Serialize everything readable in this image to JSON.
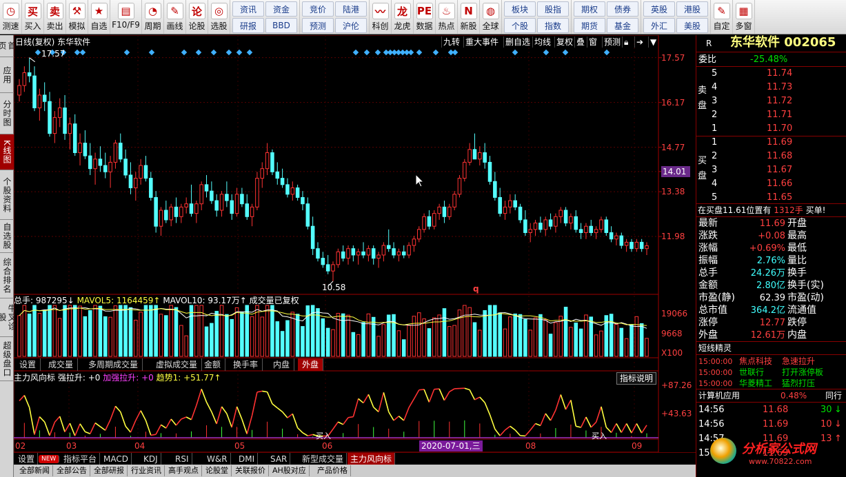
{
  "toolbar": {
    "items": [
      {
        "label": "测速",
        "icon": "stopwatch-icon",
        "glyph": "◷"
      },
      {
        "label": "买入",
        "icon": "buy-icon",
        "glyph": "买"
      },
      {
        "label": "卖出",
        "icon": "sell-icon",
        "glyph": "卖"
      },
      {
        "label": "模拟",
        "icon": "hammer-icon",
        "glyph": "⚒"
      },
      {
        "label": "自选",
        "icon": "star-icon",
        "glyph": "★"
      },
      {
        "label": "F10/F9",
        "icon": "document-icon",
        "glyph": "▤"
      },
      {
        "label": "周期",
        "icon": "clock-icon",
        "glyph": "◔"
      },
      {
        "label": "画线",
        "icon": "pen-icon",
        "glyph": "✎"
      },
      {
        "label": "论股",
        "icon": "chat-icon",
        "glyph": "论"
      },
      {
        "label": "选股",
        "icon": "target-icon",
        "glyph": "◎"
      }
    ],
    "grid1": [
      "资讯",
      "资金",
      "研报",
      "BBD"
    ],
    "grid2": [
      "竞价",
      "陆港",
      "预测",
      "沪伦"
    ],
    "items2": [
      {
        "label": "科创",
        "icon": "chart-icon",
        "glyph": "〰"
      },
      {
        "label": "龙虎",
        "icon": "dragon-icon",
        "glyph": "龙"
      },
      {
        "label": "数据",
        "icon": "pe-icon",
        "glyph": "PE"
      },
      {
        "label": "热点",
        "icon": "fire-icon",
        "glyph": "♨"
      },
      {
        "label": "新股",
        "icon": "new-stock-icon",
        "glyph": "N"
      },
      {
        "label": "全球",
        "icon": "globe-icon",
        "glyph": "◍"
      }
    ],
    "grid3": [
      "板块",
      "股指",
      "个股",
      "指数"
    ],
    "grid4": [
      "期权",
      "债券",
      "期货",
      "基金"
    ],
    "grid5": [
      "英股",
      "港股",
      "外汇",
      "美股"
    ],
    "items3": [
      {
        "label": "自定",
        "icon": "custom-icon",
        "glyph": "✎"
      },
      {
        "label": "多窗",
        "icon": "multiwindow-icon",
        "glyph": "▦"
      }
    ]
  },
  "sidetabs": [
    "首页",
    "应用",
    "分时图",
    "K线图",
    "个股资料",
    "自选股",
    "综合排名",
    "牛叉诊股",
    "超级盘口"
  ],
  "chart_header": {
    "title": "日线(复权) 东华软件",
    "buttons": [
      "九转",
      "重大事件",
      "删自选",
      "均线",
      "复权",
      "叠",
      "窗",
      "预测"
    ]
  },
  "price_axis": [
    "17.57",
    "16.17",
    "14.77",
    "14.01",
    "13.38",
    "11.98"
  ],
  "annotations": {
    "high": "17.57",
    "low": "10.58",
    "marker": "q"
  },
  "volume_header": {
    "total": "总手: 987295↓",
    "mavol5": "MAVOL5: 1164459↑",
    "mavol10": "MAVOL10: 93.17万↑",
    "note": "成交量已复权"
  },
  "volume_axis": [
    "19066",
    "9668",
    "X100"
  ],
  "volume_tabs": [
    "设置",
    "成交量",
    "多周期成交量",
    "虚拟成交量",
    "金额",
    "换手率",
    "内盘",
    "外盘"
  ],
  "indicator_header": {
    "name": "主力风向标",
    "s1": "强拉升: +0",
    "s2": "加强拉升: +0",
    "s3": "趋势1: +51.77↑",
    "btn": "指标说明"
  },
  "indicator_axis": [
    "+87.26",
    "+43.63"
  ],
  "indicator_labels": [
    "买入",
    "买入"
  ],
  "date_axis": [
    "02",
    "03",
    "04",
    "05",
    "06",
    "07",
    "08",
    "09"
  ],
  "cursor_date": "2020-07-01,三",
  "bottom_tabs": [
    "设置",
    "NEW",
    "指标平台",
    "MACD",
    "KDJ",
    "RSI",
    "W&R",
    "DMI",
    "SAR",
    "新型成交量",
    "主力风向标"
  ],
  "bottom_tabs2": [
    "全部新闻",
    "全部公告",
    "全部研报",
    "行业资讯",
    "高手观点",
    "论股堂",
    "关联报价",
    "AH股对应",
    "产品价格"
  ],
  "quote": {
    "code_flag": "R",
    "name": "东华软件",
    "code": "002065",
    "weibi_label": "委比",
    "weibi": "-25.48%",
    "sell_label": "卖盘",
    "buy_label": "买盘",
    "sells": [
      {
        "n": "5",
        "p": "11.74"
      },
      {
        "n": "4",
        "p": "11.73"
      },
      {
        "n": "3",
        "p": "11.72"
      },
      {
        "n": "2",
        "p": "11.71"
      },
      {
        "n": "1",
        "p": "11.70"
      }
    ],
    "buys": [
      {
        "n": "1",
        "p": "11.69"
      },
      {
        "n": "2",
        "p": "11.68"
      },
      {
        "n": "3",
        "p": "11.67"
      },
      {
        "n": "4",
        "p": "11.66"
      },
      {
        "n": "5",
        "p": "11.65"
      }
    ],
    "notice_a": "在买盘11.61位置有",
    "notice_b": "1312手",
    "notice_c": "买单!",
    "stats": [
      {
        "l": "最新",
        "v": "11.69",
        "c": "red",
        "l2": "开盘"
      },
      {
        "l": "涨跌",
        "v": "+0.08",
        "c": "red",
        "l2": "最高"
      },
      {
        "l": "涨幅",
        "v": "+0.69%",
        "c": "red",
        "l2": "最低"
      },
      {
        "l": "振幅",
        "v": "2.76%",
        "c": "cyan",
        "l2": "量比"
      },
      {
        "l": "总手",
        "v": "24.26万",
        "c": "cyan",
        "l2": "换手"
      },
      {
        "l": "金额",
        "v": "2.80亿",
        "c": "cyan",
        "l2": "换手(实)"
      },
      {
        "l": "市盈(静)",
        "v": "62.39",
        "c": "wht",
        "l2": "市盈(动)"
      },
      {
        "l": "总市值",
        "v": "364.2亿",
        "c": "cyan",
        "l2": "流通值"
      },
      {
        "l": "涨停",
        "v": "12.77",
        "c": "red",
        "l2": "跌停"
      },
      {
        "l": "外盘",
        "v": "12.61万",
        "c": "red",
        "l2": "内盘"
      }
    ],
    "elf_title": "短线精灵",
    "elf": [
      {
        "t": "15:00:00",
        "a": "焦点科技",
        "b": "急速拉升"
      },
      {
        "t": "15:00:00",
        "a": "世联行",
        "b": "打开涨停板"
      },
      {
        "t": "15:00:00",
        "a": "华菱精工",
        "b": "猛烈打压"
      }
    ],
    "calc_label": "计算机应用",
    "calc_pct": "0.48%",
    "calc_next": "同行",
    "ticks": [
      {
        "t": "14:56",
        "p": "11.68",
        "v": "30",
        "d": "↓",
        "c": "grn"
      },
      {
        "t": "14:56",
        "p": "11.69",
        "v": "10",
        "d": "↓",
        "c": "red"
      },
      {
        "t": "14:57",
        "p": "11.69",
        "v": "13",
        "d": "↑",
        "c": "red"
      },
      {
        "t": "15",
        "p": "11.69",
        "v": "",
        "d": "",
        "c": "red"
      }
    ],
    "watermark": "分析家公式网",
    "watermark_url": "www.70822.com"
  },
  "chart_data": {
    "type": "candlestick",
    "title": "日线(复权) 东华软件",
    "ylim": [
      10.3,
      17.8
    ],
    "x_months": [
      "02",
      "03",
      "04",
      "05",
      "06",
      "07",
      "08",
      "09"
    ],
    "ohlc": [
      [
        16.4,
        16.9,
        16.2,
        16.7
      ],
      [
        16.7,
        17.3,
        16.5,
        17.1
      ],
      [
        17.1,
        17.57,
        16.8,
        17.0
      ],
      [
        17.0,
        17.3,
        15.9,
        16.0
      ],
      [
        16.0,
        16.6,
        15.6,
        16.4
      ],
      [
        16.4,
        16.8,
        15.9,
        16.2
      ],
      [
        16.2,
        16.5,
        15.1,
        15.2
      ],
      [
        15.2,
        15.9,
        14.9,
        15.7
      ],
      [
        15.7,
        16.3,
        15.4,
        16.0
      ],
      [
        16.0,
        16.4,
        15.0,
        15.2
      ],
      [
        15.2,
        15.7,
        14.7,
        15.5
      ],
      [
        15.5,
        15.8,
        14.5,
        14.6
      ],
      [
        14.6,
        15.2,
        14.2,
        14.9
      ],
      [
        14.9,
        15.3,
        14.4,
        14.5
      ],
      [
        14.5,
        14.9,
        13.9,
        14.1
      ],
      [
        14.1,
        14.6,
        13.6,
        14.4
      ],
      [
        14.4,
        14.8,
        14.0,
        14.2
      ],
      [
        14.2,
        14.6,
        13.8,
        14.0
      ],
      [
        14.0,
        14.5,
        13.5,
        14.3
      ],
      [
        14.3,
        15.0,
        14.1,
        14.9
      ],
      [
        14.9,
        15.2,
        14.3,
        14.4
      ],
      [
        14.4,
        14.7,
        13.8,
        13.9
      ],
      [
        13.9,
        14.3,
        13.3,
        13.5
      ],
      [
        13.5,
        14.0,
        13.1,
        13.8
      ],
      [
        13.8,
        14.4,
        13.6,
        14.2
      ],
      [
        14.2,
        14.5,
        13.7,
        13.8
      ],
      [
        13.8,
        14.0,
        13.1,
        13.2
      ],
      [
        13.2,
        13.4,
        12.1,
        12.3
      ],
      [
        12.3,
        12.9,
        12.0,
        12.8
      ],
      [
        12.8,
        13.1,
        12.4,
        12.5
      ],
      [
        12.5,
        13.0,
        12.3,
        12.9
      ],
      [
        12.9,
        13.2,
        12.4,
        12.6
      ],
      [
        12.6,
        13.0,
        12.4,
        12.9
      ],
      [
        12.9,
        13.2,
        12.7,
        13.0
      ],
      [
        13.0,
        13.6,
        12.6,
        12.7
      ],
      [
        12.7,
        13.1,
        12.4,
        13.0
      ],
      [
        13.0,
        13.7,
        12.8,
        13.6
      ],
      [
        13.6,
        13.9,
        13.2,
        13.4
      ],
      [
        13.4,
        13.7,
        13.0,
        13.1
      ],
      [
        13.1,
        13.3,
        12.6,
        12.8
      ],
      [
        12.8,
        13.4,
        12.6,
        13.3
      ],
      [
        13.3,
        13.7,
        12.9,
        13.1
      ],
      [
        13.1,
        13.3,
        12.5,
        12.7
      ],
      [
        12.7,
        13.5,
        12.6,
        13.3
      ],
      [
        13.3,
        13.5,
        12.9,
        13.0
      ],
      [
        13.0,
        13.3,
        12.5,
        12.6
      ],
      [
        12.6,
        13.0,
        12.3,
        12.9
      ],
      [
        12.9,
        14.0,
        12.8,
        13.8
      ],
      [
        13.8,
        14.3,
        13.5,
        14.1
      ],
      [
        14.1,
        14.9,
        13.9,
        14.6
      ],
      [
        14.6,
        14.7,
        13.9,
        14.0
      ],
      [
        14.0,
        14.3,
        13.6,
        13.8
      ],
      [
        13.8,
        14.1,
        13.5,
        13.6
      ],
      [
        13.6,
        13.8,
        13.2,
        13.3
      ],
      [
        13.3,
        13.7,
        13.1,
        13.5
      ],
      [
        13.5,
        13.6,
        13.1,
        13.2
      ],
      [
        13.2,
        13.4,
        12.8,
        13.0
      ],
      [
        13.0,
        13.2,
        12.2,
        12.3
      ],
      [
        12.3,
        12.6,
        11.4,
        11.6
      ],
      [
        11.6,
        11.8,
        11.2,
        11.3
      ],
      [
        11.3,
        11.5,
        11.0,
        11.1
      ],
      [
        11.1,
        11.4,
        10.8,
        10.9
      ],
      [
        10.9,
        11.2,
        10.58,
        11.1
      ],
      [
        11.1,
        11.6,
        11.0,
        11.5
      ],
      [
        11.5,
        11.7,
        11.2,
        11.3
      ],
      [
        11.3,
        11.7,
        11.1,
        11.6
      ],
      [
        11.6,
        11.7,
        11.2,
        11.4
      ],
      [
        11.4,
        11.6,
        11.1,
        11.5
      ],
      [
        11.5,
        11.8,
        11.3,
        11.4
      ],
      [
        11.4,
        11.7,
        11.2,
        11.6
      ],
      [
        11.6,
        11.7,
        11.1,
        11.3
      ],
      [
        11.3,
        11.5,
        11.0,
        11.4
      ],
      [
        11.4,
        11.8,
        11.2,
        11.7
      ],
      [
        11.7,
        12.2,
        11.5,
        11.6
      ],
      [
        11.6,
        11.8,
        11.3,
        11.4
      ],
      [
        11.4,
        11.6,
        11.2,
        11.5
      ],
      [
        11.5,
        11.7,
        11.3,
        11.4
      ],
      [
        11.4,
        11.8,
        11.3,
        11.7
      ],
      [
        11.7,
        12.0,
        11.5,
        11.9
      ],
      [
        11.9,
        12.3,
        11.8,
        12.2
      ],
      [
        12.2,
        12.7,
        12.1,
        12.6
      ],
      [
        12.6,
        12.8,
        12.2,
        12.3
      ],
      [
        12.3,
        12.8,
        12.2,
        12.7
      ],
      [
        12.7,
        13.0,
        12.5,
        12.9
      ],
      [
        12.9,
        13.1,
        12.4,
        12.6
      ],
      [
        12.6,
        13.0,
        12.5,
        12.9
      ],
      [
        12.9,
        13.4,
        12.8,
        13.3
      ],
      [
        13.3,
        13.9,
        13.2,
        13.8
      ],
      [
        13.8,
        14.4,
        13.7,
        14.3
      ],
      [
        14.3,
        14.9,
        14.2,
        14.7
      ],
      [
        14.7,
        15.2,
        14.5,
        14.4
      ],
      [
        14.4,
        14.8,
        14.2,
        14.6
      ],
      [
        14.6,
        14.9,
        14.1,
        14.3
      ],
      [
        14.3,
        14.5,
        13.6,
        13.7
      ],
      [
        13.7,
        14.0,
        13.1,
        13.2
      ],
      [
        13.2,
        13.5,
        12.6,
        12.7
      ],
      [
        12.7,
        13.1,
        12.5,
        12.9
      ],
      [
        12.9,
        13.3,
        12.7,
        13.1
      ],
      [
        13.1,
        13.3,
        12.8,
        12.9
      ],
      [
        12.9,
        13.0,
        12.4,
        12.5
      ],
      [
        12.5,
        12.8,
        12.0,
        12.1
      ],
      [
        12.1,
        12.4,
        11.8,
        12.2
      ],
      [
        12.2,
        12.5,
        12.0,
        12.4
      ],
      [
        12.4,
        12.6,
        12.1,
        12.2
      ],
      [
        12.2,
        12.6,
        12.0,
        12.5
      ],
      [
        12.5,
        12.7,
        12.2,
        12.3
      ],
      [
        12.3,
        12.7,
        12.1,
        12.6
      ],
      [
        12.6,
        12.9,
        12.4,
        12.8
      ],
      [
        12.8,
        12.9,
        12.3,
        12.4
      ],
      [
        12.4,
        12.7,
        12.2,
        12.6
      ],
      [
        12.6,
        12.8,
        12.1,
        12.2
      ],
      [
        12.2,
        12.4,
        11.9,
        12.1
      ],
      [
        12.1,
        12.4,
        11.9,
        12.3
      ],
      [
        12.3,
        12.5,
        12.0,
        12.1
      ],
      [
        12.1,
        12.3,
        11.9,
        12.2
      ],
      [
        12.2,
        12.6,
        12.1,
        12.5
      ],
      [
        12.5,
        12.6,
        12.0,
        12.1
      ],
      [
        12.1,
        12.3,
        11.8,
        11.9
      ],
      [
        11.9,
        12.1,
        11.7,
        12.0
      ],
      [
        12.0,
        12.1,
        11.6,
        11.7
      ],
      [
        11.7,
        11.9,
        11.5,
        11.8
      ],
      [
        11.8,
        11.9,
        11.5,
        11.6
      ],
      [
        11.6,
        11.9,
        11.5,
        11.8
      ],
      [
        11.8,
        11.9,
        11.5,
        11.6
      ],
      [
        11.6,
        11.8,
        11.4,
        11.69
      ]
    ]
  }
}
